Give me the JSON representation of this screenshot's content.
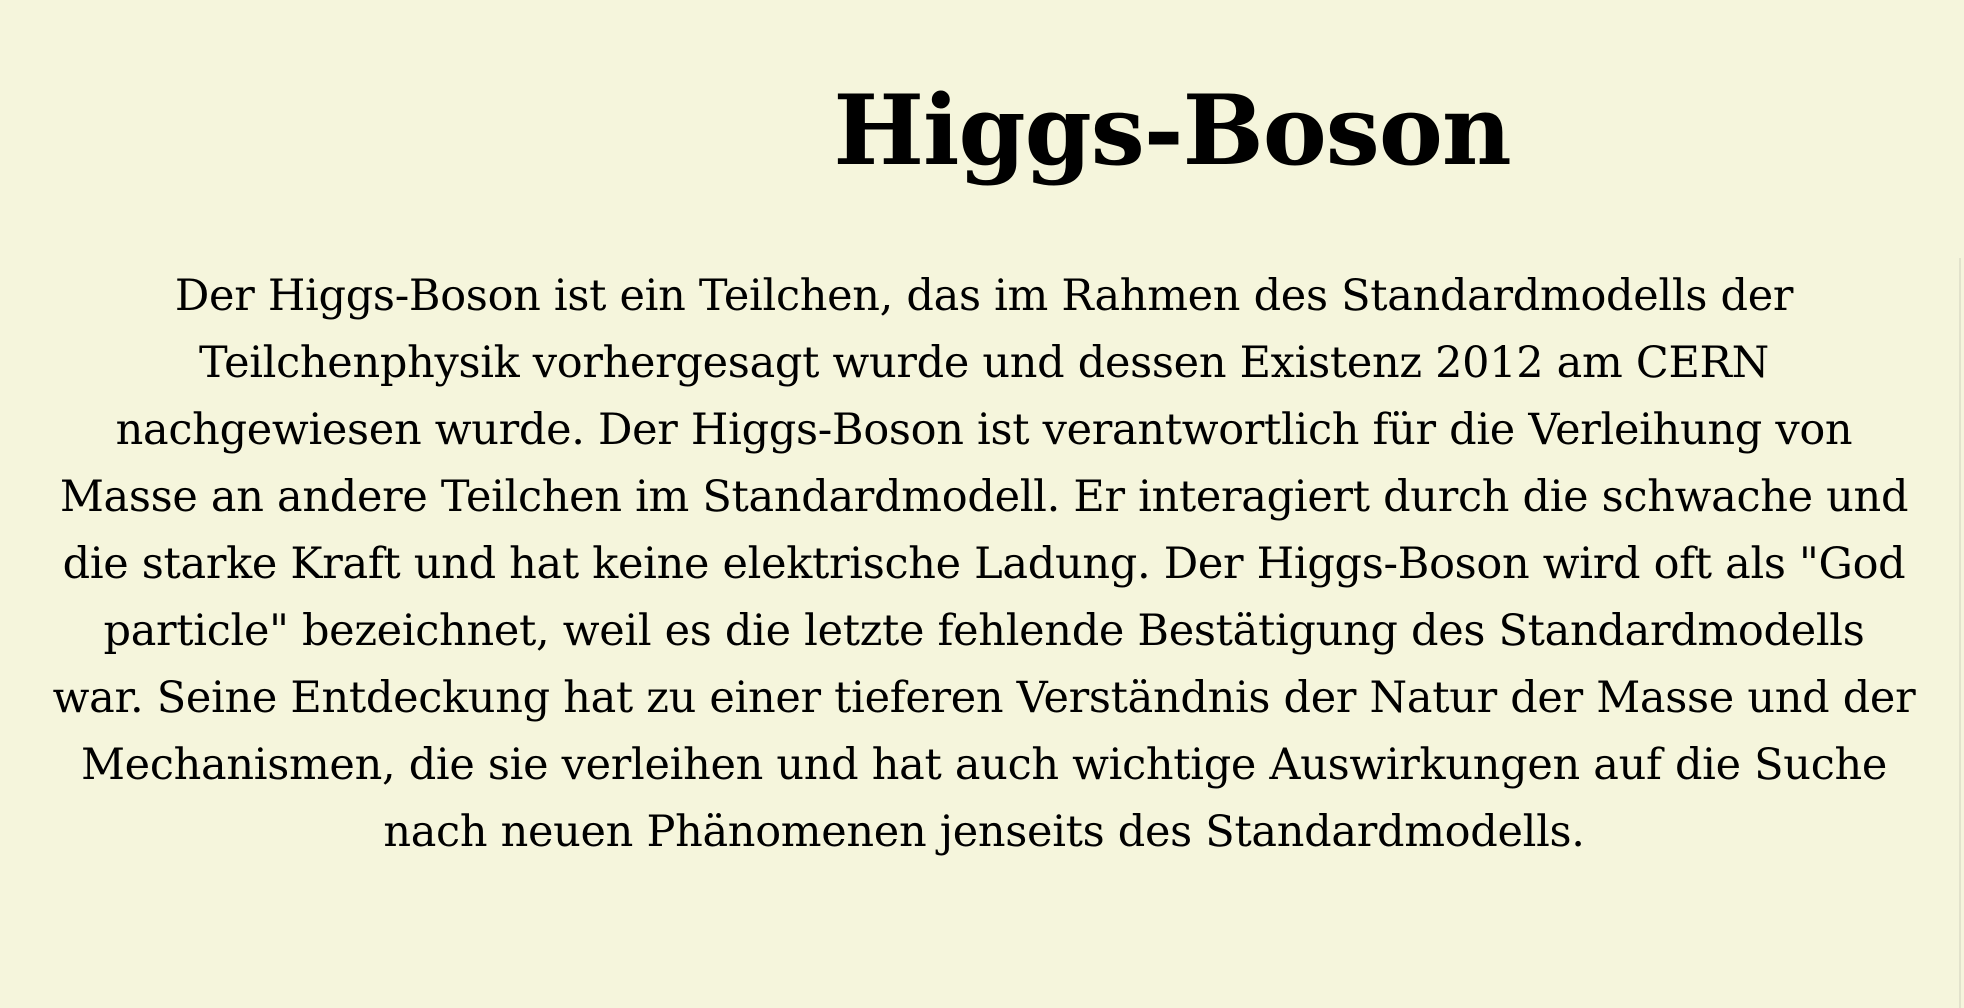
{
  "article": {
    "title": "Higgs-Boson",
    "body": "Der Higgs-Boson ist ein Teilchen, das im Rahmen des Standardmodells der Teilchenphysik vorhergesagt wurde und dessen Existenz 2012 am CERN nachgewiesen wurde. Der Higgs-Boson ist verantwortlich für die Verleihung von Masse an andere Teilchen im Standardmodell. Er interagiert durch die schwache und die starke Kraft und hat keine elektrische Ladung. Der Higgs-Boson wird oft als \"God particle\" bezeichnet, weil es die letzte fehlende Bestätigung des Standardmodells war. Seine Entdeckung hat zu einer tieferen Verständnis der Natur der Masse und der Mechanismen, die sie verleihen und hat auch wichtige Auswirkungen auf die Suche nach neuen Phänomenen jenseits des Standardmodells."
  },
  "colors": {
    "background": "#f5f5dc",
    "text": "#000000"
  }
}
